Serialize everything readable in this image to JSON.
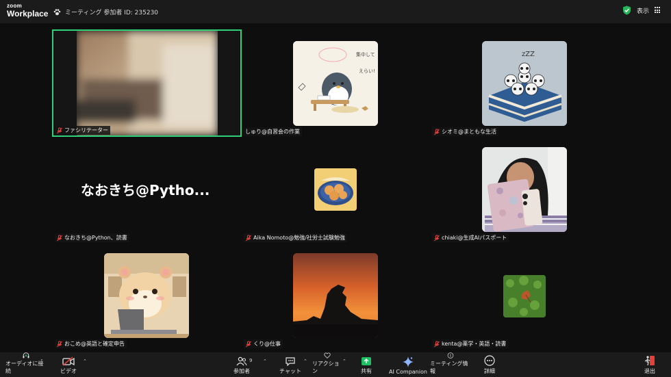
{
  "app": {
    "logo_top": "zoom",
    "logo_bottom": "Workplace"
  },
  "header": {
    "meeting_info": "ミーティング 参加者 ID: 235230",
    "view_label": "表示"
  },
  "participants": [
    {
      "name": "ファシリテーター",
      "muted": true
    },
    {
      "name": "しゅり@自習会の作業",
      "muted": false
    },
    {
      "name": "シオミ@まともな生活",
      "muted": true
    },
    {
      "name": "なおきち@Python、読書",
      "muted": true,
      "display_name": "なおきち@Pytho..."
    },
    {
      "name": "Aika Nomoto@勉強/社労士試験勉強",
      "muted": true
    },
    {
      "name": "chiaki@生成AIパスポート",
      "muted": true
    },
    {
      "name": "おこめ@英語と確定申告",
      "muted": true
    },
    {
      "name": "くり@仕事",
      "muted": true
    },
    {
      "name": "kenta@薬学・英語・読書",
      "muted": true
    }
  ],
  "toolbar": {
    "audio": "オーディオに接続",
    "video": "ビデオ",
    "participants": "参加者",
    "participants_count": "9",
    "chat": "チャット",
    "reactions": "リアクション",
    "share": "共有",
    "ai_companion": "AI Companion",
    "meeting_info": "ミーティング情報",
    "more": "詳細",
    "leave": "退出"
  },
  "colors": {
    "active_speaker": "#2fd07a",
    "share_green": "#1fbf64",
    "leave_red": "#e5413c",
    "muted_red": "#e5413c"
  }
}
